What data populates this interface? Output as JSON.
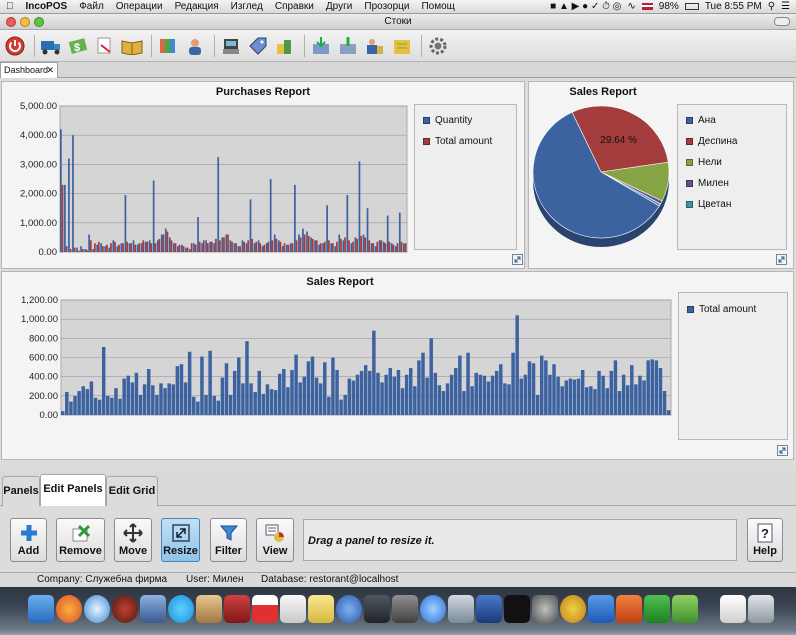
{
  "menubar": {
    "app_name": "IncoPOS",
    "menus": [
      "Файл",
      "Операции",
      "Редакция",
      "Изглед",
      "Справки",
      "Други",
      "Прозорци",
      "Помощ"
    ],
    "battery": "98%",
    "clock": "Tue 8:55 PM"
  },
  "window": {
    "title": "Стоки"
  },
  "tabs": {
    "dashboard_label": "Dashboard",
    "close_glyph": "✕"
  },
  "purchases": {
    "title": "Purchases Report",
    "yticks": [
      "5,000.00",
      "4,000.00",
      "3,000.00",
      "2,000.00",
      "1,000.00",
      "0.00"
    ],
    "legend": [
      {
        "label": "Quantity",
        "color": "#3d62a0"
      },
      {
        "label": "Total amount",
        "color": "#a33d3d"
      }
    ]
  },
  "sales_pie": {
    "title": "Sales Report",
    "slice_label": "29.64 %",
    "legend": [
      {
        "label": "Ана",
        "color": "#3d62a0"
      },
      {
        "label": "Деспина",
        "color": "#a33d3d"
      },
      {
        "label": "Нели",
        "color": "#86a443"
      },
      {
        "label": "Милен",
        "color": "#6a4d8f"
      },
      {
        "label": "Цветан",
        "color": "#3d94a9"
      }
    ]
  },
  "sales_bar": {
    "title": "Sales Report",
    "yticks": [
      "1,200.00",
      "1,000.00",
      "800.00",
      "600.00",
      "400.00",
      "200.00",
      "0.00"
    ],
    "legend": [
      {
        "label": "Total amount",
        "color": "#3d62a0"
      }
    ]
  },
  "chart_data": [
    {
      "type": "bar",
      "title": "Purchases Report",
      "ylim": [
        0,
        5000
      ],
      "grid": true,
      "legend_position": "right",
      "series": [
        {
          "name": "Quantity",
          "values": [
            4200,
            2300,
            3200,
            4000,
            150,
            200,
            100,
            600,
            100,
            250,
            300,
            200,
            150,
            400,
            200,
            300,
            1950,
            300,
            400,
            250,
            300,
            350,
            400,
            2450,
            400,
            600,
            800,
            500,
            300,
            200,
            250,
            150,
            100,
            300,
            1200,
            300,
            400,
            350,
            300,
            3250,
            500,
            600,
            400,
            300,
            200,
            400,
            300,
            1800,
            300,
            400,
            200,
            300,
            2500,
            600,
            400,
            200,
            250,
            300,
            2300,
            600,
            800,
            700,
            500,
            400,
            250,
            300,
            1600,
            300,
            200,
            600,
            400,
            1950,
            300,
            500,
            3100,
            600,
            1500,
            300,
            200,
            400,
            350,
            1250,
            300,
            200,
            1350,
            300
          ]
        },
        {
          "name": "Total amount",
          "values": [
            2300,
            200,
            100,
            150,
            50,
            100,
            80,
            400,
            300,
            350,
            200,
            250,
            300,
            350,
            250,
            300,
            350,
            300,
            250,
            300,
            400,
            350,
            300,
            300,
            450,
            600,
            700,
            400,
            300,
            250,
            200,
            150,
            300,
            250,
            350,
            400,
            300,
            350,
            450,
            400,
            500,
            600,
            350,
            300,
            200,
            350,
            400,
            450,
            350,
            300,
            250,
            350,
            400,
            450,
            350,
            300,
            250,
            300,
            400,
            500,
            600,
            550,
            450,
            400,
            300,
            350,
            400,
            300,
            350,
            450,
            500,
            400,
            350,
            450,
            550,
            500,
            400,
            300,
            350,
            400,
            300,
            350,
            250,
            300,
            350,
            300
          ]
        }
      ]
    },
    {
      "type": "pie",
      "title": "Sales Report",
      "legend_position": "right",
      "categories": [
        "Ана",
        "Деспина",
        "Нели",
        "Милен",
        "Цветан"
      ],
      "values": [
        59.4,
        29.64,
        9.6,
        0.8,
        0.56
      ],
      "labels": [
        "",
        "29.64 %",
        "",
        "",
        ""
      ]
    },
    {
      "type": "bar",
      "title": "Sales Report",
      "ylim": [
        0,
        1200
      ],
      "grid": true,
      "legend_position": "right",
      "series": [
        {
          "name": "Total amount",
          "values": [
            40,
            240,
            140,
            200,
            250,
            300,
            270,
            350,
            180,
            160,
            710,
            200,
            180,
            280,
            170,
            380,
            410,
            340,
            440,
            210,
            320,
            480,
            310,
            210,
            330,
            280,
            330,
            320,
            510,
            530,
            340,
            660,
            190,
            140,
            610,
            210,
            670,
            200,
            150,
            390,
            540,
            210,
            460,
            600,
            330,
            770,
            330,
            240,
            460,
            220,
            320,
            270,
            260,
            430,
            480,
            290,
            470,
            630,
            340,
            400,
            560,
            610,
            390,
            330,
            550,
            190,
            600,
            470,
            160,
            210,
            380,
            360,
            420,
            460,
            520,
            460,
            880,
            440,
            340,
            420,
            490,
            400,
            470,
            280,
            420,
            490,
            300,
            570,
            650,
            390,
            800,
            440,
            310,
            250,
            330,
            420,
            490,
            620,
            250,
            650,
            300,
            440,
            420,
            410,
            350,
            410,
            460,
            530,
            330,
            320,
            650,
            1040,
            380,
            420,
            560,
            540,
            210,
            620,
            570,
            420,
            530,
            400,
            300,
            360,
            380,
            370,
            380,
            470,
            290,
            300,
            270,
            460,
            410,
            280,
            460,
            570,
            250,
            420,
            310,
            520,
            320,
            410,
            360,
            570,
            580,
            570,
            490,
            250,
            50
          ]
        }
      ]
    }
  ],
  "bottom_tabs": [
    "Panels",
    "Edit Panels",
    "Edit Grid"
  ],
  "actions": {
    "add": "Add",
    "remove": "Remove",
    "move": "Move",
    "resize": "Resize",
    "filter": "Filter",
    "view": "View",
    "help": "Help",
    "message": "Drag a panel to resize it."
  },
  "status": {
    "company": "Company: Служебна фирма",
    "user": "User: Милен",
    "database": "Database: restorant@localhost"
  }
}
